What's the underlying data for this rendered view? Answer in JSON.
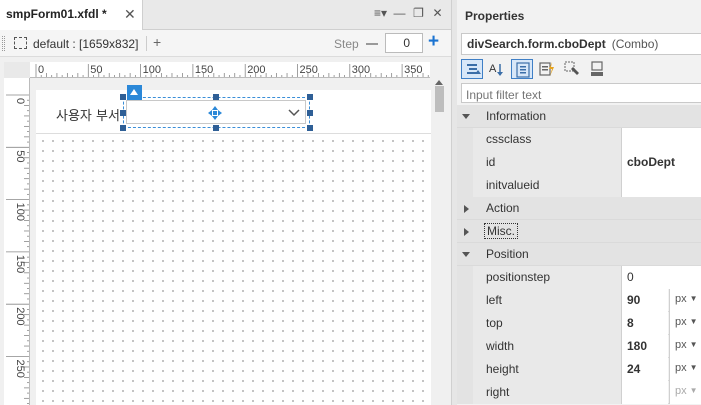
{
  "tab": {
    "title": "smpForm01.xfdl *",
    "close": "✕"
  },
  "window_controls": [
    "≡▾",
    "—",
    "❐",
    "✕"
  ],
  "form_toolbar": {
    "size": "default : [1659x832]",
    "add": "+",
    "step_label": "Step",
    "step_value": "0",
    "step_plus": "+"
  },
  "ruler_h": [
    "0",
    "50",
    "100",
    "150",
    "200",
    "250",
    "300",
    "350"
  ],
  "ruler_v": [
    "0",
    "50",
    "100",
    "150",
    "200",
    "250"
  ],
  "form": {
    "label_text": "사용자 부서"
  },
  "properties": {
    "title": "Properties",
    "target_name": "divSearch.form.cboDept",
    "target_type": "(Combo)",
    "filter_placeholder": "Input filter text",
    "rows": [
      {
        "type": "cat",
        "open": true,
        "name": "Information"
      },
      {
        "type": "prop",
        "name": "cssclass",
        "value": ""
      },
      {
        "type": "prop",
        "name": "id",
        "value": "cboDept",
        "bold": true
      },
      {
        "type": "prop",
        "name": "initvalueid",
        "value": ""
      },
      {
        "type": "cat",
        "open": false,
        "name": "Action"
      },
      {
        "type": "cat",
        "open": false,
        "name": "Misc.",
        "focus": true
      },
      {
        "type": "cat",
        "open": true,
        "name": "Position"
      },
      {
        "type": "prop",
        "name": "positionstep",
        "value": "0"
      },
      {
        "type": "prop",
        "name": "left",
        "value": "90",
        "bold": true,
        "unit": "px"
      },
      {
        "type": "prop",
        "name": "top",
        "value": "8",
        "bold": true,
        "unit": "px"
      },
      {
        "type": "prop",
        "name": "width",
        "value": "180",
        "bold": true,
        "unit": "px"
      },
      {
        "type": "prop",
        "name": "height",
        "value": "24",
        "bold": true,
        "unit": "px"
      },
      {
        "type": "prop",
        "name": "right",
        "value": "",
        "unit": "px",
        "dim": true
      }
    ]
  },
  "colors": {
    "accent": "#2b88d8",
    "handle": "#2f5f96"
  }
}
